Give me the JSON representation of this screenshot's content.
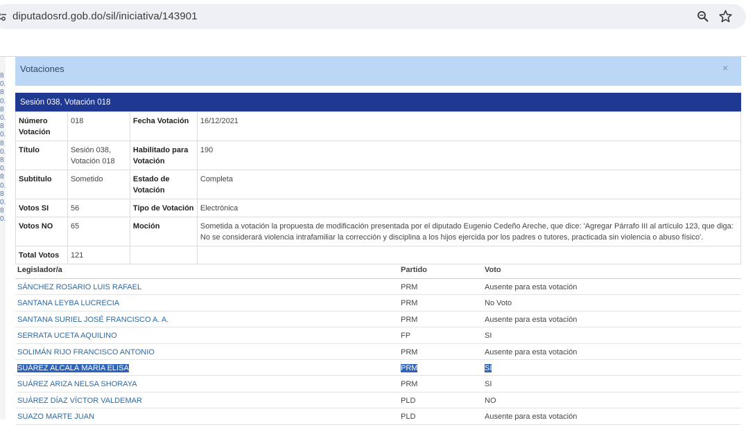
{
  "browser": {
    "url": "diputadosrd.gob.do/sil/iniciativa/143901"
  },
  "left_strip": [
    "8",
    "0.",
    "8",
    "0.",
    "8",
    "0.",
    "8",
    "0.",
    "8",
    "0.",
    "8",
    "0.",
    "8",
    "0.",
    "8",
    "0.",
    "8",
    "0."
  ],
  "modal": {
    "title": "Votaciones",
    "close_label": "×",
    "session_header": "Sesión 038, Votación 018",
    "details": {
      "numero_label": "Número Votación",
      "numero_value": "018",
      "fecha_label": "Fecha Votación",
      "fecha_value": "16/12/2021",
      "titulo_label": "Título",
      "titulo_value": "Sesión 038, Votación 018",
      "habilitado_label": "Habilitado para Votación",
      "habilitado_value": "190",
      "subtitulo_label": "Subtitulo",
      "subtitulo_value": "Sometido",
      "estado_label": "Estado de Votación",
      "estado_value": "Completa",
      "votos_si_label": "Votos SI",
      "votos_si_value": "56",
      "tipo_label": "Tipo de Votación",
      "tipo_value": "Electrónica",
      "votos_no_label": "Votos NO",
      "votos_no_value": "65",
      "mocion_label": "Moción",
      "mocion_value": "Sometida a votación la propuesta de modificación presentada por el diputado Eugenio Cedeño Areche, que dice: 'Agregar Párrafo III al artículo 123, que diga: No se considerará violencia intrafamiliar la corrección y disciplina a los hijos ejercida por los padres o tutores, practicada sin violencia o abuso físico'.",
      "total_label": "Total Votos",
      "total_value": "121"
    },
    "votes_table": {
      "headers": {
        "legislador": "Legislador/a",
        "partido": "Partido",
        "voto": "Voto"
      },
      "rows": [
        {
          "name": "SÁNCHEZ ROSARIO LUIS RAFAEL",
          "party": "PRM",
          "vote": "Ausente para esta votación"
        },
        {
          "name": "SANTANA LEYBA LUCRECIA",
          "party": "PRM",
          "vote": "No Voto"
        },
        {
          "name": "SANTANA SURIEL JOSÉ FRANCISCO A. A.",
          "party": "PRM",
          "vote": "Ausente para esta votación"
        },
        {
          "name": "SERRATA UCETA AQUILINO",
          "party": "FP",
          "vote": "SI"
        },
        {
          "name": "SOLIMÁN RIJO FRANCISCO ANTONIO",
          "party": "PRM",
          "vote": "Ausente para esta votación"
        },
        {
          "name": "SUÁREZ ALCALÁ MARÍA ELISA",
          "party": "PRM",
          "vote": "SI"
        },
        {
          "name": "SUÁREZ ARIZA NELSA SHORAYA",
          "party": "PRM",
          "vote": "SI"
        },
        {
          "name": "SUÁREZ DÍAZ VÍCTOR VALDEMAR",
          "party": "PLD",
          "vote": "NO"
        },
        {
          "name": "SUAZO MARTE JUAN",
          "party": "PLD",
          "vote": "Ausente para esta votación"
        }
      ]
    }
  }
}
